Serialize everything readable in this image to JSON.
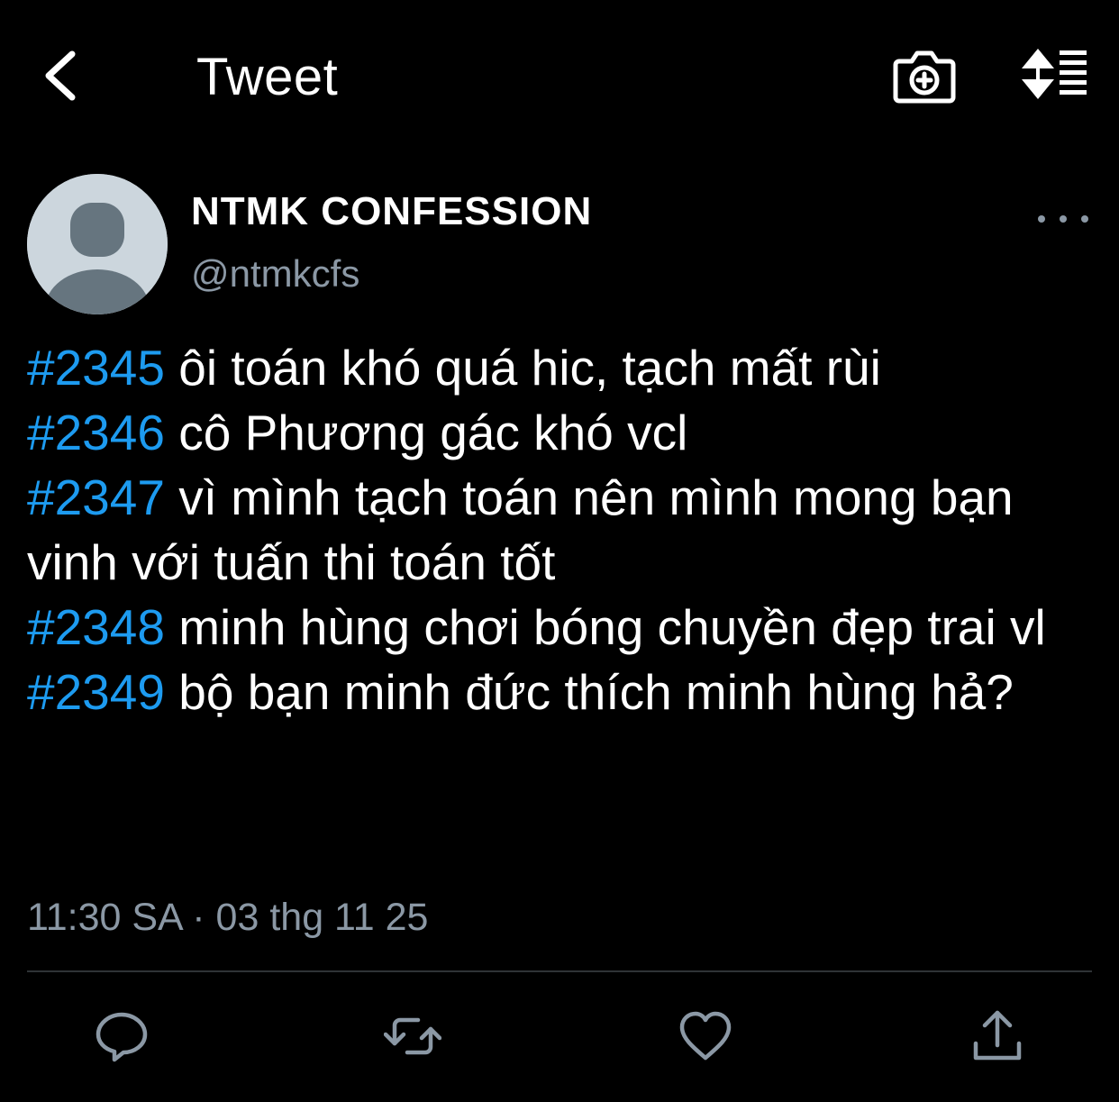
{
  "header": {
    "title": "Tweet",
    "back_icon": "back-chevron-icon",
    "camera_icon": "camera-add-icon",
    "sort_icon": "sort-list-icon"
  },
  "author": {
    "display_name": "NTMK CONFESSION",
    "handle": "@ntmkcfs",
    "avatar_icon": "default-avatar-icon"
  },
  "tweet": {
    "lines": [
      {
        "tag": "#2345",
        "text": " ôi toán khó quá hic, tạch mất rùi"
      },
      {
        "tag": "#2346",
        "text": " cô Phương gác khó vcl"
      },
      {
        "tag": "#2347",
        "text": " vì mình tạch toán nên mình mong bạn vinh với tuấn thi toán tốt"
      },
      {
        "tag": "#2348",
        "text": " minh hùng chơi bóng chuyền đẹp trai vl"
      },
      {
        "tag": "#2349",
        "text": " bộ bạn minh đức thích minh hùng hả?"
      }
    ],
    "timestamp": "11:30 SA · 03 thg 11 25"
  },
  "actions": {
    "reply_icon": "reply-icon",
    "retweet_icon": "retweet-icon",
    "like_icon": "like-icon",
    "share_icon": "share-icon"
  },
  "colors": {
    "background": "#000000",
    "hashtag": "#1d9bf0",
    "secondary_text": "#8b98a5",
    "icon": "#8b98a5"
  }
}
